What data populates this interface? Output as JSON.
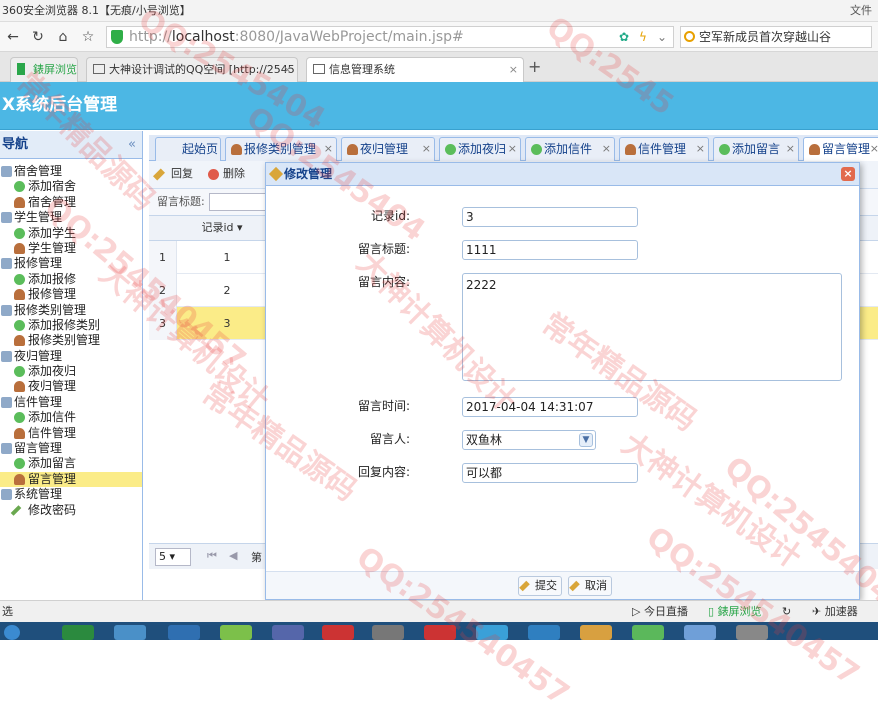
{
  "browser": {
    "window_title": "360安全浏览器 8.1【无痕/小号浏览】",
    "title_right": "文件",
    "url_host": "localhost",
    "url_rest": ":8080/JavaWebProject/main.jsp#",
    "url_scheme": "http://",
    "search_text": "空军新成员首次穿越山谷",
    "tabs": [
      {
        "label": "錶屏浏览"
      },
      {
        "label": "大神设计调试的QQ空间 [http://2545"
      },
      {
        "label": "信息管理系统"
      }
    ]
  },
  "app": {
    "header_title": "X系统后台管理",
    "nav_title": "导航",
    "nav_collapse": "«"
  },
  "nav": [
    {
      "label": "宿舍管理",
      "type": "group"
    },
    {
      "label": "添加宿舍",
      "type": "add"
    },
    {
      "label": "宿舍管理",
      "type": "user"
    },
    {
      "label": "学生管理",
      "type": "group"
    },
    {
      "label": "添加学生",
      "type": "add"
    },
    {
      "label": "学生管理",
      "type": "user"
    },
    {
      "label": "报修管理",
      "type": "group"
    },
    {
      "label": "添加报修",
      "type": "add"
    },
    {
      "label": "报修管理",
      "type": "user"
    },
    {
      "label": "报修类别管理",
      "type": "group"
    },
    {
      "label": "添加报修类别",
      "type": "add"
    },
    {
      "label": "报修类别管理",
      "type": "user"
    },
    {
      "label": "夜归管理",
      "type": "group"
    },
    {
      "label": "添加夜归",
      "type": "add"
    },
    {
      "label": "夜归管理",
      "type": "user"
    },
    {
      "label": "信件管理",
      "type": "group"
    },
    {
      "label": "添加信件",
      "type": "add"
    },
    {
      "label": "信件管理",
      "type": "user"
    },
    {
      "label": "留言管理",
      "type": "group"
    },
    {
      "label": "添加留言",
      "type": "add"
    },
    {
      "label": "留言管理",
      "type": "user",
      "selected": true
    },
    {
      "label": "系统管理",
      "type": "group"
    },
    {
      "label": "修改密码",
      "type": "pen"
    }
  ],
  "content_tabs": [
    "起始页",
    "报修类别管理",
    "夜归管理",
    "添加夜归",
    "添加信件",
    "信件管理",
    "添加留言",
    "留言管理"
  ],
  "toolbar": {
    "reply": "回复",
    "delete": "删除"
  },
  "filter_label": "留言标题:",
  "grid": {
    "column": "记录id",
    "rows": [
      {
        "num": "1",
        "id": "1"
      },
      {
        "num": "2",
        "id": "2"
      },
      {
        "num": "3",
        "id": "3",
        "selected": true
      }
    ],
    "page_size": "5",
    "pager_text": "第"
  },
  "dialog": {
    "title": "修改管理",
    "fields": {
      "record_id_label": "记录id:",
      "record_id_value": "3",
      "title_label": "留言标题:",
      "title_value": "1111",
      "content_label": "留言内容:",
      "content_value": "2222",
      "time_label": "留言时间:",
      "time_value": "2017-04-04 14:31:07",
      "person_label": "留言人:",
      "person_value": "双鱼林",
      "reply_label": "回复内容:",
      "reply_value": "可以都"
    },
    "submit": "提交",
    "cancel": "取消"
  },
  "statusbar": {
    "left": "选",
    "live": "今日直播",
    "view": "錶屏浏览",
    "speed": "加速器"
  },
  "watermarks": [
    "QQ:2545404",
    "常年精品源码",
    "大神计算机设计",
    "QQ:254540457",
    "QQ:2545404",
    "常年精品源码",
    "大神计算机设计",
    "QQ:254540457",
    "QQ:2545",
    "常年精品源码",
    "大神计算机设计",
    "QQ:254540457",
    "QQ:254540457"
  ],
  "colors": {
    "header": "#4cb7e4",
    "selected": "#fbec88",
    "panel_border": "#99bbe8"
  }
}
